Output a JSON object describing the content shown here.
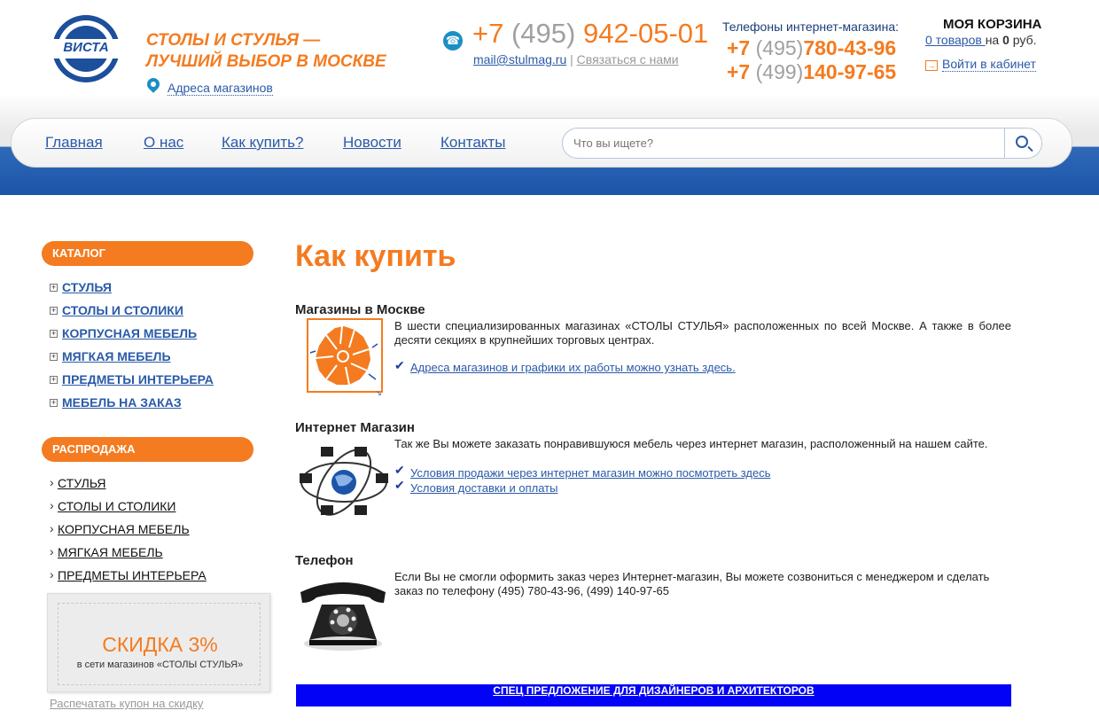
{
  "header": {
    "logo_text": "ВИСТА",
    "slogan_line1": "СТОЛЫ И СТУЛЬЯ —",
    "slogan_line2": "ЛУЧШИЙ ВЫБОР В МОСКВЕ",
    "stores_link": "Адреса магазинов",
    "main_phone_prefix": "+7 ",
    "main_phone_code": "(495)",
    "main_phone_number": " 942-05-01",
    "email": "mail@stulmag.ru",
    "separator": "|",
    "contact_link": "Связаться с нами",
    "shop_phones_title": "Телефоны интернет-магазина:",
    "shop_phone1_prefix": "+7 ",
    "shop_phone1_code": "(495)",
    "shop_phone1_number": "780-43-96",
    "shop_phone2_prefix": "+7 ",
    "shop_phone2_code": "(499)",
    "shop_phone2_number": "140-97-65",
    "cart_title": "МОЯ КОРЗИНА",
    "cart_items_link": "0 товаров ",
    "cart_on": "на ",
    "cart_amount": "0",
    "cart_currency": " руб.",
    "login_link": "Войти в кабинет"
  },
  "nav": {
    "items": [
      "Главная",
      "О нас",
      "Как купить?",
      "Новости",
      "Контакты"
    ],
    "search_placeholder": "Что вы ищете?"
  },
  "sidebar": {
    "catalog_title": "КАТАЛОГ",
    "catalog_items": [
      "СТУЛЬЯ",
      "СТОЛЫ И СТОЛИКИ",
      "КОРПУСНАЯ МЕБЕЛЬ",
      "МЯГКАЯ МЕБЕЛЬ",
      "ПРЕДМЕТЫ ИНТЕРЬЕРА",
      "МЕБЕЛЬ НА ЗАКАЗ"
    ],
    "sale_title": "РАСПРОДАЖА",
    "sale_items": [
      "СТУЛЬЯ",
      "СТОЛЫ И СТОЛИКИ",
      "КОРПУСНАЯ МЕБЕЛЬ",
      "МЯГКАЯ МЕБЕЛЬ",
      "ПРЕДМЕТЫ ИНТЕРЬЕРА"
    ],
    "coupon_discount": "СКИДКА 3%",
    "coupon_text": "в сети магазинов «СТОЛЫ СТУЛЬЯ»",
    "print_coupon": "Распечатать купон на скидку"
  },
  "content": {
    "title": "Как купить",
    "stores": {
      "title": "Магазины в Москве",
      "text": " В шести специализированных магазинах «СТОЛЫ СТУЛЬЯ» расположенных по всей Москве. А также в более десяти секциях в крупнейших торговых центрах.",
      "link": "Адреса магазинов и графики их работы можно узнать здесь."
    },
    "online": {
      "title": "Интернет Магазин",
      "text": "Так же Вы можете заказать понравившуюся мебель через интернет магазин, расположенный на нашем сайте.",
      "link1": "Условия продажи через интернет магазин можно посмотреть здесь ",
      "link2": "Условия доставки и оплаты"
    },
    "phone": {
      "title": "Телефон",
      "text_line1": "Если Вы не смогли оформить заказ через Интернет-магазин, Вы можете созвониться с менеджером и сделать",
      "text_line2": "заказ по телефону (495) 780-43-96, (499) 140-97-65"
    },
    "special_offer": "СПЕЦ ПРЕДЛОЖЕНИЕ ДЛЯ ДИЗАЙНЕРОВ И АРХИТЕКТОРОВ"
  },
  "colors": {
    "accent_orange": "#f47b20",
    "link_blue": "#2a5aa8",
    "header_blue": "#1c55a8",
    "special_bar": "#0202f6"
  }
}
